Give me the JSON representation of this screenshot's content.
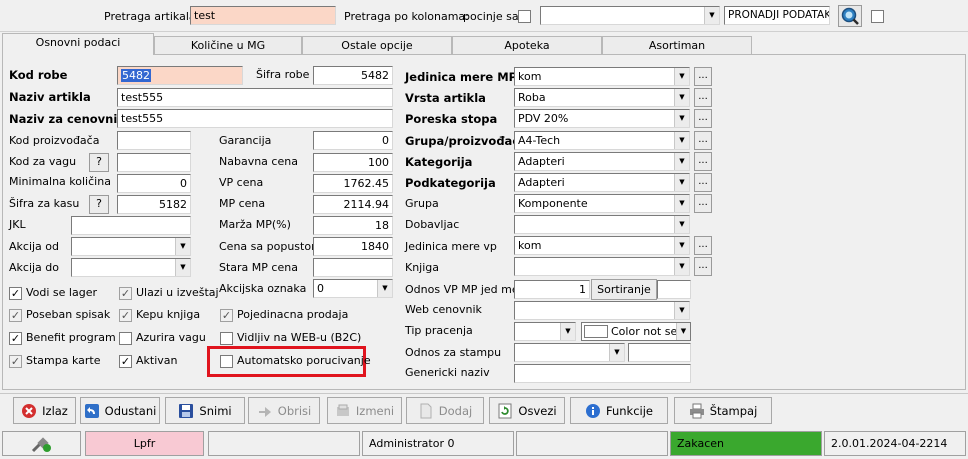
{
  "search": {
    "label_artikal": "Pretraga artikala",
    "value_artikal": "test",
    "label_kolone": "Pretraga po kolonama:",
    "mode": "pocinje sa",
    "find_button": "PRONADJI PODATAK"
  },
  "tabs": [
    "Osnovni podaci",
    "Količine u MG",
    "Ostale opcije",
    "Apoteka",
    "Asortiman"
  ],
  "left": {
    "kod_robe_label": "Kod robe",
    "kod_robe_value": "5482",
    "sifra_robe_label": "Šifra robe",
    "sifra_robe_value": "5482",
    "naziv_artikla_label": "Naziv artikla",
    "naziv_artikla_value": "test555",
    "naziv_cenovnik_label": "Naziv za cenovnik",
    "naziv_cenovnik_value": "test555",
    "kod_proizvodjaca_label": "Kod proizvođača",
    "kod_za_vagu_label": "Kod za vagu",
    "min_kolicina_label": "Minimalna količina",
    "min_kolicina_value": "0",
    "sifra_kasa_label": "Šifra za kasu",
    "sifra_kasa_value": "5182",
    "jkl_label": "JKL",
    "akcija_od_label": "Akcija od",
    "akcija_do_label": "Akcija do",
    "q": "?"
  },
  "mid": {
    "garancija_label": "Garancija",
    "garancija_value": "0",
    "nabavna_label": "Nabavna cena",
    "nabavna_value": "100",
    "vp_label": "VP cena",
    "vp_value": "1762.45",
    "mp_label": "MP cena",
    "mp_value": "2114.94",
    "marza_label": "Marža MP(%)",
    "marza_value": "18",
    "popust_label": "Cena sa popustom",
    "popust_value": "1840",
    "stara_label": "Stara MP cena",
    "akcijska_label": "Akcijska oznaka",
    "akcijska_value": "0"
  },
  "right": {
    "jm_label": "Jedinica mere MP",
    "jm_value": "kom",
    "vrsta_label": "Vrsta artikla",
    "vrsta_value": "Roba",
    "poreska_label": "Poreska stopa",
    "poreska_value": "PDV 20%",
    "grupa_p_label": "Grupa/proizvođač",
    "grupa_p_value": "A4-Tech",
    "kategorija_label": "Kategorija",
    "kategorija_value": "Adapteri",
    "podkategorija_label": "Podkategorija",
    "podkategorija_value": "Adapteri",
    "grupa_label": "Grupa",
    "grupa_value": "Komponente",
    "dobavljac_label": "Dobavljac",
    "jm_vp_label": "Jedinica mere vp",
    "jm_vp_value": "kom",
    "knjiga_label": "Knjiga",
    "odnos_label": "Odnos VP MP jed mere",
    "odnos_value": "1",
    "sortiranje": "Sortiranje",
    "web_label": "Web cenovnik",
    "tip_label": "Tip pracenja",
    "color_value": "Color not sel",
    "odnos_stampu_label": "Odnos za stampu",
    "genericki_label": "Genericki naziv",
    "dots": "..."
  },
  "checks": [
    {
      "label": "Vodi se lager",
      "checked": true
    },
    {
      "label": "Ulazi u izveštaj",
      "checked": true
    },
    {
      "label": "Poseban spisak",
      "checked": true
    },
    {
      "label": "Kepu knjiga",
      "checked": true
    },
    {
      "label": "Pojedinacna prodaja",
      "checked": true
    },
    {
      "label": "Benefit program",
      "checked": true
    },
    {
      "label": "Azurira vagu",
      "checked": false
    },
    {
      "label": "Vidljiv na WEB-u (B2C)",
      "checked": false
    },
    {
      "label": "Stampa karte",
      "checked": true
    },
    {
      "label": "Aktivan",
      "checked": true
    },
    {
      "label": "Automatsko porucivanje",
      "checked": false
    }
  ],
  "toolbar": {
    "izlaz": "Izlaz",
    "odustani": "Odustani",
    "snimi": "Snimi",
    "obrisi": "Obrisi",
    "izmeni": "Izmeni",
    "dodaj": "Dodaj",
    "osvezi": "Osvezi",
    "funkcije": "Funkcije",
    "stampaj": "Štampaj"
  },
  "status": {
    "lpfr": "Lpfr",
    "user": "Administrator 0",
    "state": "Zakacen",
    "version": "2.0.01.2024-04-2214"
  },
  "colors": {
    "highlight_field": "#fbd7c7",
    "status_green": "#3aa82e",
    "annotation_red": "#e0141e"
  }
}
